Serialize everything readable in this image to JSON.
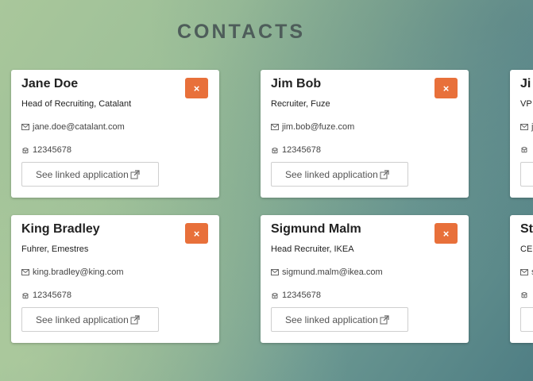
{
  "page": {
    "title": "CONTACTS"
  },
  "contacts": [
    {
      "name": "Jane Doe",
      "role": "Head of Recruiting, Catalant",
      "email": "jane.doe@catalant.com",
      "phone": "12345678",
      "link_label": "See linked application",
      "delete_label": "×"
    },
    {
      "name": "Jim Bob",
      "role": "Recruiter, Fuze",
      "email": "jim.bob@fuze.com",
      "phone": "12345678",
      "link_label": "See linked application",
      "delete_label": "×"
    },
    {
      "name": "Ji",
      "role": "VP",
      "email": "j",
      "phone": "",
      "link_label": "",
      "delete_label": ""
    },
    {
      "name": "King Bradley",
      "role": "Fuhrer, Emestres",
      "email": "king.bradley@king.com",
      "phone": "12345678",
      "link_label": "See linked application",
      "delete_label": "×"
    },
    {
      "name": "Sigmund Malm",
      "role": "Head Recruiter, IKEA",
      "email": "sigmund.malm@ikea.com",
      "phone": "12345678",
      "link_label": "See linked application",
      "delete_label": "×"
    },
    {
      "name": "St",
      "role": "CE",
      "email": "s",
      "phone": "",
      "link_label": "",
      "delete_label": ""
    }
  ],
  "icons": {
    "email": "envelope-icon",
    "phone": "telephone-icon",
    "link": "external-link-icon",
    "delete": "close-icon"
  },
  "colors": {
    "accent": "#e8703a",
    "title": "#4e5d5a",
    "card": "#ffffff"
  }
}
